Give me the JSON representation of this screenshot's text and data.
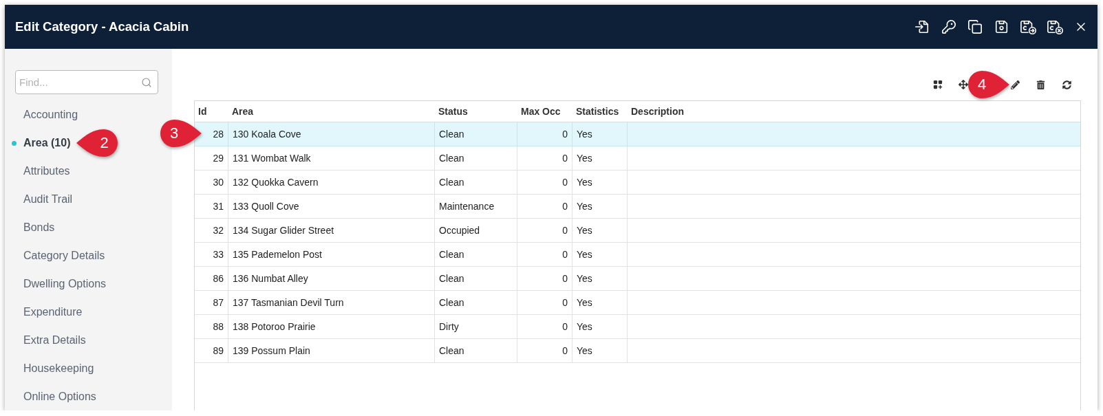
{
  "window": {
    "title": "Edit Category - Acacia Cabin"
  },
  "sidebar": {
    "search": {
      "placeholder": "Find..."
    },
    "items": [
      {
        "label": "Accounting",
        "selected": false
      },
      {
        "label": "Area (10)",
        "selected": true,
        "callout": "2"
      },
      {
        "label": "Attributes",
        "selected": false
      },
      {
        "label": "Audit Trail",
        "selected": false
      },
      {
        "label": "Bonds",
        "selected": false
      },
      {
        "label": "Category Details",
        "selected": false
      },
      {
        "label": "Dwelling Options",
        "selected": false
      },
      {
        "label": "Expenditure",
        "selected": false
      },
      {
        "label": "Extra Details",
        "selected": false
      },
      {
        "label": "Housekeeping",
        "selected": false
      },
      {
        "label": "Online Options",
        "selected": false
      }
    ]
  },
  "toolbar": {
    "callout": "4"
  },
  "table": {
    "columns": [
      "Id",
      "Area",
      "Status",
      "Max Occ",
      "Statistics",
      "Description"
    ],
    "rows": [
      {
        "id": "28",
        "area": "130 Koala Cove",
        "status": "Clean",
        "max_occ": "0",
        "statistics": "Yes",
        "selected": true,
        "callout": "3"
      },
      {
        "id": "29",
        "area": "131 Wombat Walk",
        "status": "Clean",
        "max_occ": "0",
        "statistics": "Yes",
        "selected": false
      },
      {
        "id": "30",
        "area": "132 Quokka Cavern",
        "status": "Clean",
        "max_occ": "0",
        "statistics": "Yes",
        "selected": false
      },
      {
        "id": "31",
        "area": "133 Quoll Cove",
        "status": "Maintenance",
        "max_occ": "0",
        "statistics": "Yes",
        "selected": false
      },
      {
        "id": "32",
        "area": "134 Sugar Glider Street",
        "status": "Occupied",
        "max_occ": "0",
        "statistics": "Yes",
        "selected": false
      },
      {
        "id": "33",
        "area": "135 Pademelon Post",
        "status": "Clean",
        "max_occ": "0",
        "statistics": "Yes",
        "selected": false
      },
      {
        "id": "86",
        "area": "136 Numbat Alley",
        "status": "Clean",
        "max_occ": "0",
        "statistics": "Yes",
        "selected": false
      },
      {
        "id": "87",
        "area": "137 Tasmanian Devil Turn",
        "status": "Clean",
        "max_occ": "0",
        "statistics": "Yes",
        "selected": false
      },
      {
        "id": "88",
        "area": "138 Potoroo Prairie",
        "status": "Dirty",
        "max_occ": "0",
        "statistics": "Yes",
        "selected": false
      },
      {
        "id": "89",
        "area": "139 Possum Plain",
        "status": "Clean",
        "max_occ": "0",
        "statistics": "Yes",
        "selected": false
      }
    ]
  }
}
